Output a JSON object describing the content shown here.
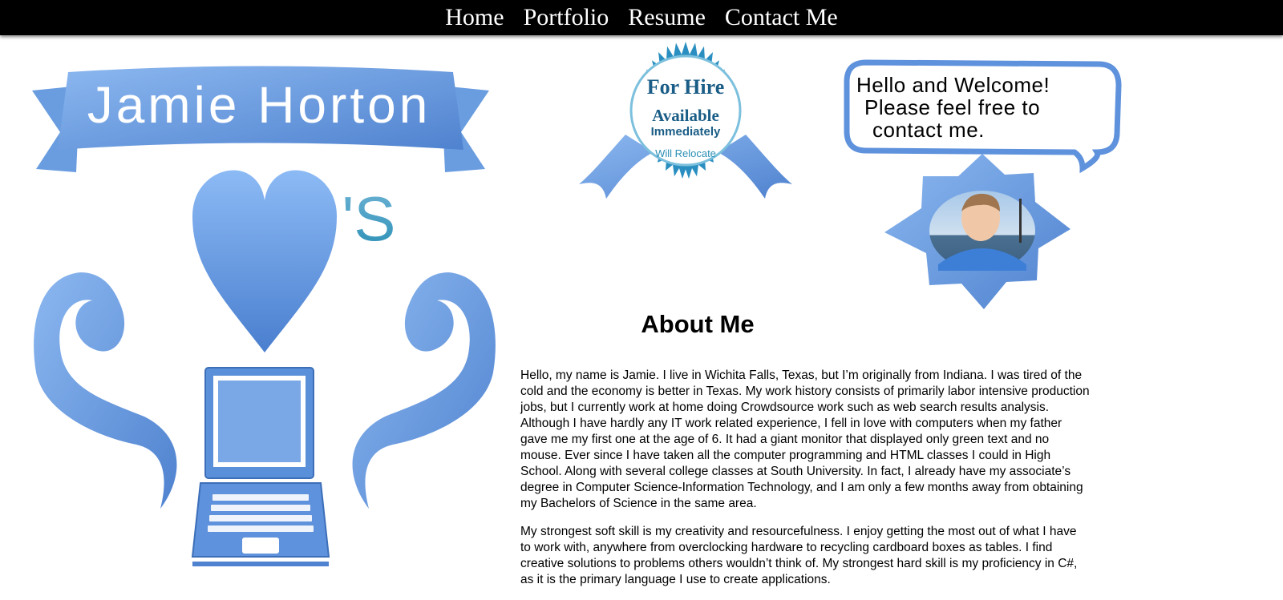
{
  "nav": {
    "items": [
      {
        "label": "Home"
      },
      {
        "label": "Portfolio"
      },
      {
        "label": "Resume"
      },
      {
        "label": "Contact Me"
      }
    ]
  },
  "banner": {
    "name": "Jamie Horton",
    "possessive": "'S"
  },
  "badge": {
    "line1": "For Hire",
    "line2": "Available",
    "line3": "Immediately",
    "line4": "Will Relocate"
  },
  "bubble": {
    "line1": "Hello and Welcome!",
    "line2": "Please feel free to",
    "line3": "contact me."
  },
  "about": {
    "title": "About Me",
    "paragraphs": [
      "Hello, my name is Jamie. I live in Wichita Falls, Texas, but I’m originally from Indiana. I was tired of the cold and the economy is better in Texas. My work history consists of primarily labor intensive production jobs, but I currently work at home doing Crowdsource work such as web search results analysis. Although I have hardly any IT work related experience, I fell in love with computers when my father gave me my first one at the age of 6. It had a giant monitor that displayed only green text and no mouse. Ever since I have taken all the computer programming and HTML classes I could in High School. Along with several college classes at South University. In fact, I already have my associate’s degree in Computer Science-Information Technology, and I am only a few months away from obtaining my Bachelors of Science in the same area.",
      "My strongest soft skill is my creativity and resourcefulness. I enjoy getting the most out of what I have to work with, anywhere from overclocking hardware to recycling cardboard boxes as tables. I find creative solutions to problems others wouldn’t think of. My strongest hard skill is my proficiency in C#, as it is the primary language I use to create applications."
    ]
  },
  "colors": {
    "accent": "#7aa7e6",
    "accent_dark": "#4f82cf",
    "teal": "#2a8fb5",
    "badge_text": "#1a5d86"
  }
}
